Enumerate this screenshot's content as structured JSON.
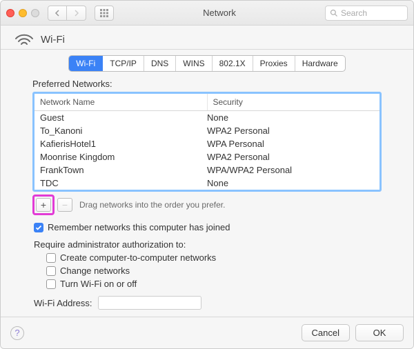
{
  "window": {
    "title": "Network",
    "search_placeholder": "Search"
  },
  "header": {
    "title": "Wi-Fi"
  },
  "tabs": [
    "Wi-Fi",
    "TCP/IP",
    "DNS",
    "WINS",
    "802.1X",
    "Proxies",
    "Hardware"
  ],
  "active_tab_index": 0,
  "preferred_label": "Preferred Networks:",
  "columns": {
    "name": "Network Name",
    "security": "Security"
  },
  "networks": [
    {
      "name": "Guest",
      "security": "None"
    },
    {
      "name": "To_Kanoni",
      "security": "WPA2 Personal"
    },
    {
      "name": "KafierisHotel1",
      "security": "WPA Personal"
    },
    {
      "name": "Moonrise Kingdom",
      "security": "WPA2 Personal"
    },
    {
      "name": "FrankTown",
      "security": "WPA/WPA2 Personal"
    },
    {
      "name": "TDC",
      "security": "None"
    }
  ],
  "drag_hint": "Drag networks into the order you prefer.",
  "remember": {
    "checked": true,
    "label": "Remember networks this computer has joined"
  },
  "require_admin": {
    "label": "Require administrator authorization to:",
    "opts": [
      {
        "checked": false,
        "label": "Create computer-to-computer networks"
      },
      {
        "checked": false,
        "label": "Change networks"
      },
      {
        "checked": false,
        "label": "Turn Wi-Fi on or off"
      }
    ]
  },
  "wifi_address": {
    "label": "Wi-Fi Address:",
    "value": ""
  },
  "buttons": {
    "cancel": "Cancel",
    "ok": "OK"
  }
}
